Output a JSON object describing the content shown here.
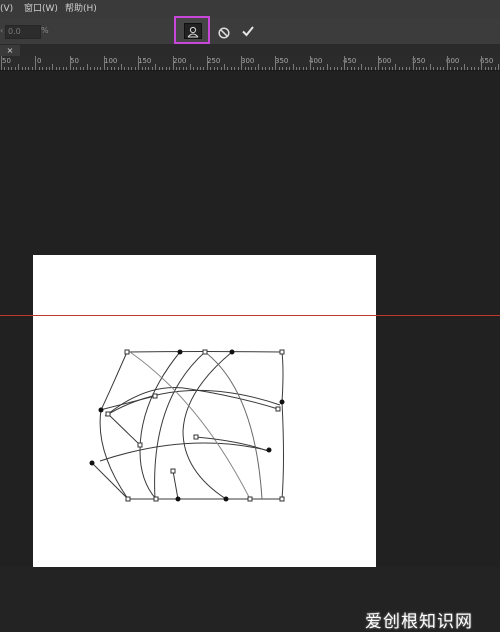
{
  "menubar": {
    "items": [
      {
        "label": "(V)"
      },
      {
        "label": "窗口(W)"
      },
      {
        "label": "帮助(H)"
      }
    ]
  },
  "options": {
    "field_value": "0.0",
    "unit": "%",
    "lead": "‹"
  },
  "mode_button": {
    "icon": "warp-mode-icon"
  },
  "cancel_button": {
    "icon": "cancel-icon"
  },
  "commit_button": {
    "icon": "checkmark-icon"
  },
  "tab": {
    "close_label": "×"
  },
  "ruler": {
    "labels": [
      "50",
      "0",
      "50",
      "100",
      "150",
      "200",
      "250",
      "300",
      "350",
      "400",
      "450",
      "500",
      "550",
      "600",
      "650"
    ]
  },
  "colors": {
    "highlight": "#c846d8",
    "guide": "#c0392b",
    "canvas_bg": "#212121",
    "document": "#ffffff"
  },
  "watermark": {
    "text": "爱创根知识网"
  }
}
